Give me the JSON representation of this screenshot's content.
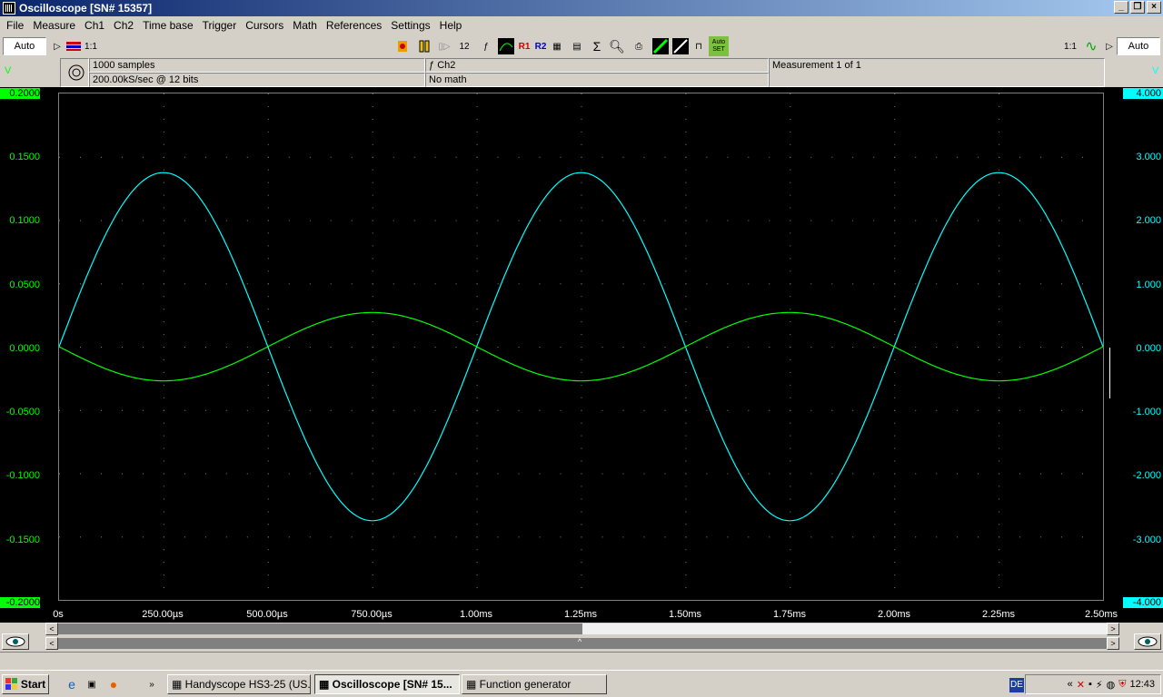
{
  "window": {
    "title": "Oscilloscope  [SN# 15357]"
  },
  "menu": [
    "File",
    "Measure",
    "Ch1",
    "Ch2",
    "Time base",
    "Trigger",
    "Cursors",
    "Math",
    "References",
    "Settings",
    "Help"
  ],
  "toolbar": {
    "auto_left": "Auto",
    "auto_right": "Auto",
    "ratio_left": "1:1",
    "ratio_right": "1:1",
    "btn_12": "12",
    "btn_r1": "R1",
    "btn_r2": "R2",
    "btn_autoset": "Auto SET"
  },
  "info": {
    "samples": "1000 samples",
    "rate": "200.00kS/sec @ 12 bits",
    "trigger_channel": "Ch2",
    "math": "No math",
    "measurement": "Measurement 1 of 1"
  },
  "axes": {
    "left_unit": "V",
    "right_unit": "V",
    "left_ticks": [
      "0.2000",
      "0.1500",
      "0.1000",
      "0.0500",
      "0.0000",
      "-0.0500",
      "-0.1000",
      "-0.1500",
      "-0.2000"
    ],
    "right_ticks": [
      "4.000",
      "3.000",
      "2.000",
      "1.000",
      "0.000",
      "-1.000",
      "-2.000",
      "-3.000",
      "-4.000"
    ],
    "x_ticks": [
      "0s",
      "250.00µs",
      "500.00µs",
      "750.00µs",
      "1.00ms",
      "1.25ms",
      "1.50ms",
      "1.75ms",
      "2.00ms",
      "2.25ms",
      "2.50ms"
    ]
  },
  "chart_data": {
    "type": "line",
    "x_range_ms": [
      0,
      2.5
    ],
    "series": [
      {
        "axis": "right",
        "color": "#00ffff",
        "amplitude_V": 2.75,
        "period_ms": 1.0,
        "phase": "sin"
      },
      {
        "axis": "left",
        "color": "#00ff00",
        "amplitude_V": 0.027,
        "period_ms": 1.0,
        "phase": "-sin"
      }
    ],
    "left_ylim": [
      -0.2,
      0.2
    ],
    "right_ylim": [
      -4.0,
      4.0
    ],
    "grid": true
  },
  "taskbar": {
    "start": "Start",
    "tasks": [
      "Handyscope HS3-25 (US...",
      "Oscilloscope  [SN# 15...",
      "Function generator"
    ],
    "lang": "DE",
    "clock": "12:43"
  }
}
